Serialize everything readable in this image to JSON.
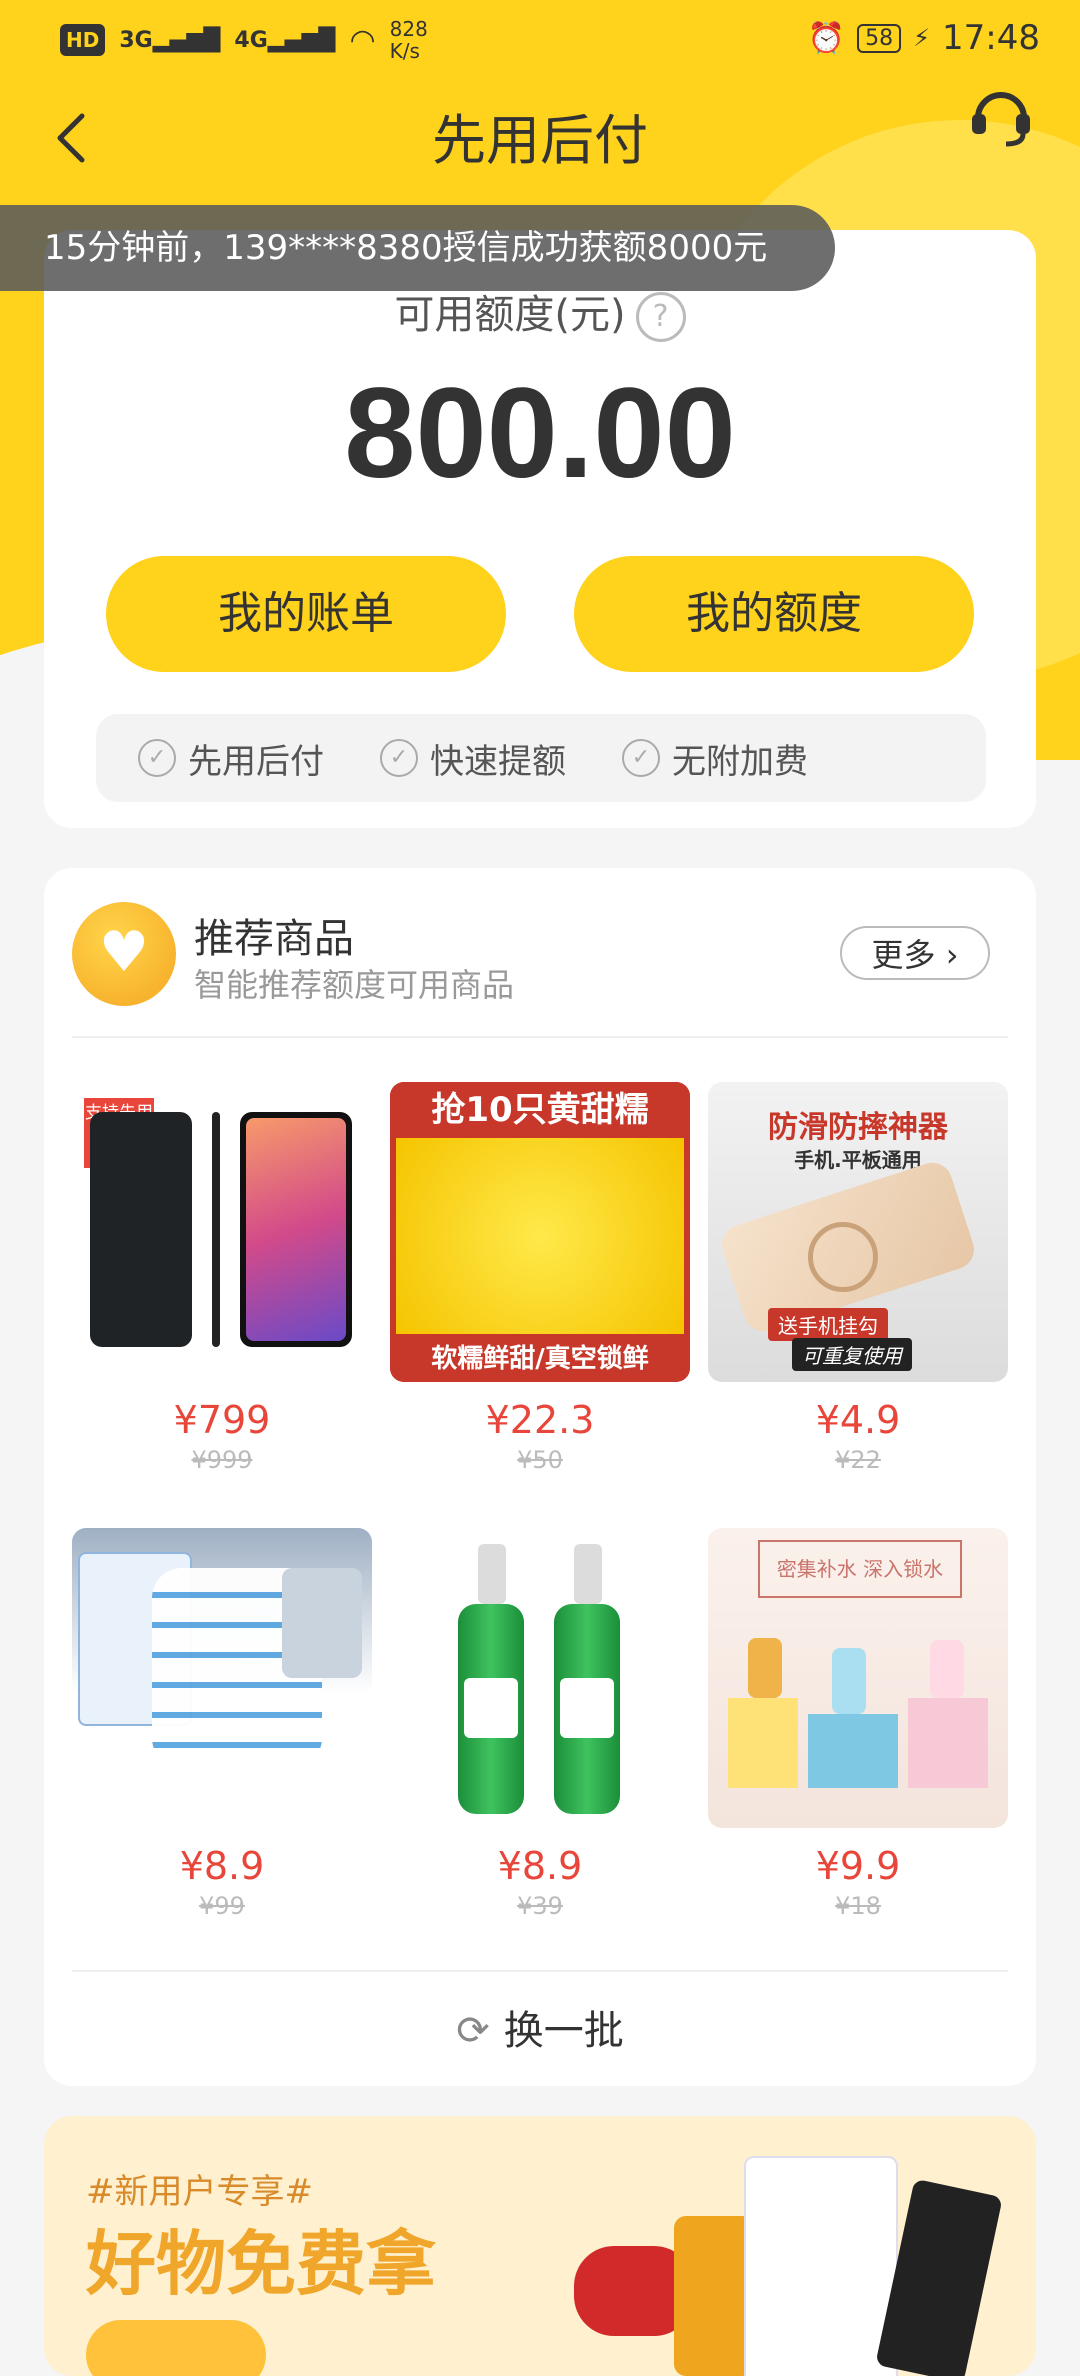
{
  "status_bar": {
    "hd": "HD",
    "signal1": "3G",
    "signal2": "4G",
    "speed_value": "828",
    "speed_unit": "K/s",
    "battery": "58",
    "time": "17:48"
  },
  "nav": {
    "title": "先用后付"
  },
  "toast": {
    "text": "15分钟前，139****8380授信成功获额8000元"
  },
  "credit": {
    "label": "可用额度(元)",
    "amount": "800.00",
    "bill_button": "我的账单",
    "quota_button": "我的额度",
    "features": [
      "先用后付",
      "快速提额",
      "无附加费"
    ]
  },
  "recommend": {
    "title": "推荐商品",
    "subtitle": "智能推荐额度可用商品",
    "more": "更多",
    "refresh": "换一批",
    "products": [
      {
        "price": "¥799",
        "original": "¥999",
        "badge": "支持先用后付"
      },
      {
        "price": "¥22.3",
        "original": "¥50",
        "img_top": "抢10只黄甜糯",
        "img_bottom": "软糯鲜甜/真空锁鲜"
      },
      {
        "price": "¥4.9",
        "original": "¥22",
        "img_top": "防滑防摔神器",
        "img_sub": "手机.平板通用",
        "img_tag1": "送手机挂勾",
        "img_tag2": "可重复使用"
      },
      {
        "price": "¥8.9",
        "original": "¥99"
      },
      {
        "price": "¥8.9",
        "original": "¥39"
      },
      {
        "price": "¥9.9",
        "original": "¥18",
        "img_top": "密集补水 深入锁水"
      }
    ]
  },
  "banner": {
    "tag": "#新用户专享#",
    "title": "好物免费拿"
  }
}
